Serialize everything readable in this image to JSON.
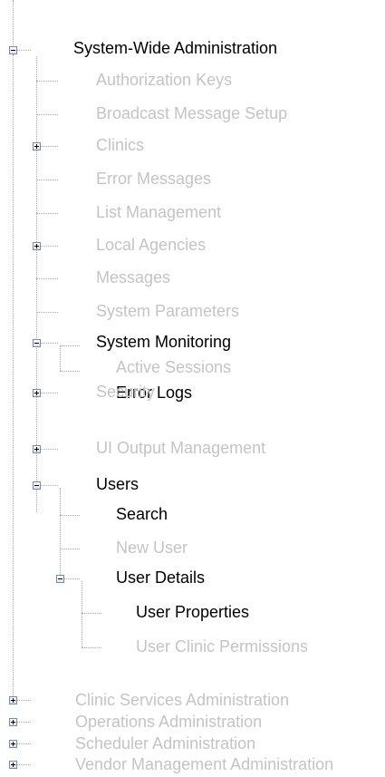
{
  "tree": {
    "root": {
      "label": "System-Wide Administration",
      "expanded": true,
      "children": [
        {
          "label": "Authorization Keys",
          "state": "disabled"
        },
        {
          "label": "Broadcast Message Setup",
          "state": "disabled"
        },
        {
          "label": "Clinics",
          "state": "disabled",
          "expandable": true,
          "expanded": false
        },
        {
          "label": "Error Messages",
          "state": "disabled"
        },
        {
          "label": "List Management",
          "state": "disabled"
        },
        {
          "label": "Local Agencies",
          "state": "disabled",
          "expandable": true,
          "expanded": false
        },
        {
          "label": "Messages",
          "state": "disabled"
        },
        {
          "label": "System Parameters",
          "state": "disabled"
        },
        {
          "label": "System Monitoring",
          "state": "enabled",
          "expandable": true,
          "expanded": true,
          "children": [
            {
              "label": "Active Sessions",
              "state": "disabled"
            },
            {
              "label": "Error Logs",
              "state": "enabled"
            }
          ]
        },
        {
          "label": "Security",
          "state": "disabled",
          "expandable": true,
          "expanded": false
        },
        {
          "label": "UI Output Management",
          "state": "disabled",
          "expandable": true,
          "expanded": false
        },
        {
          "label": "Users",
          "state": "enabled",
          "expandable": true,
          "expanded": true,
          "children": [
            {
              "label": "Search",
              "state": "enabled"
            },
            {
              "label": "New User",
              "state": "disabled"
            },
            {
              "label": "User Details",
              "state": "enabled",
              "expandable": true,
              "expanded": true,
              "children": [
                {
                  "label": "User Properties",
                  "state": "enabled"
                },
                {
                  "label": "User Clinic Permissions",
                  "state": "disabled"
                }
              ]
            }
          ]
        }
      ]
    },
    "top_level_collapsed": [
      {
        "label": "Clinic Services Administration",
        "state": "disabled"
      },
      {
        "label": "Operations Administration",
        "state": "disabled"
      },
      {
        "label": "Scheduler Administration",
        "state": "disabled"
      },
      {
        "label": "Vendor Management Administration",
        "state": "disabled"
      }
    ]
  },
  "colors": {
    "enabled_text": "#000000",
    "disabled_text": "#c4c4c4",
    "connector": "#a8a8a8"
  }
}
